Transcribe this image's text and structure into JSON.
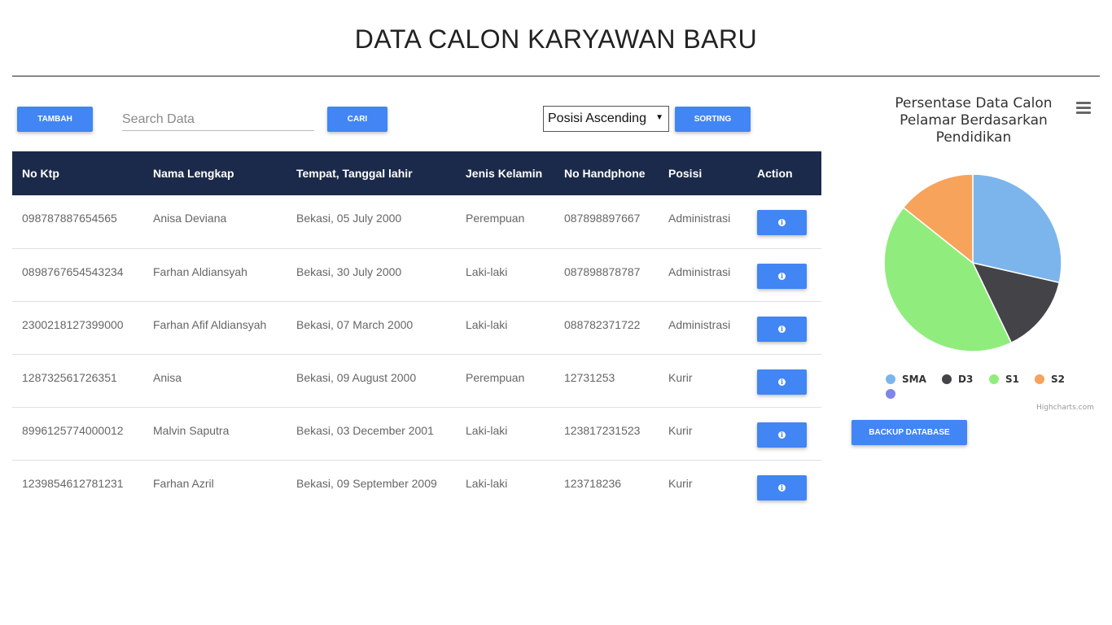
{
  "header": {
    "title": "DATA CALON KARYAWAN BARU"
  },
  "toolbar": {
    "add_label": "TAMBAH",
    "search_placeholder": "Search Data",
    "search_value": "",
    "search_label": "CARI",
    "sort_selected": "Posisi Ascending",
    "sort_label": "SORTING"
  },
  "table": {
    "columns": [
      "No Ktp",
      "Nama Lengkap",
      "Tempat, Tanggal lahir",
      "Jenis Kelamin",
      "No Handphone",
      "Posisi",
      "Action"
    ],
    "rows": [
      [
        "098787887654565",
        "Anisa Deviana",
        "Bekasi, 05 July 2000",
        "Perempuan",
        "087898897667",
        "Administrasi"
      ],
      [
        "0898767654543234",
        "Farhan Aldiansyah",
        "Bekasi, 30 July 2000",
        "Laki-laki",
        "087898878787",
        "Administrasi"
      ],
      [
        "2300218127399000",
        "Farhan Afif Aldiansyah",
        "Bekasi, 07 March 2000",
        "Laki-laki",
        "088782371722",
        "Administrasi"
      ],
      [
        "128732561726351",
        "Anisa",
        "Bekasi, 09 August 2000",
        "Perempuan",
        "12731253",
        "Kurir"
      ],
      [
        "8996125774000012",
        "Malvin Saputra",
        "Bekasi, 03 December 2001",
        "Laki-laki",
        "123817231523",
        "Kurir"
      ],
      [
        "1239854612781231",
        "Farhan Azril",
        "Bekasi, 09 September 2009",
        "Laki-laki",
        "123718236",
        "Kurir"
      ]
    ],
    "action_icon": "info-icon"
  },
  "chart_data": {
    "type": "pie",
    "title": "Persentase Data Calon Pelamar Berdasarkan Pendidikan",
    "series": [
      {
        "name": "SMA",
        "value": 2,
        "color": "#7cb5ec"
      },
      {
        "name": "D3",
        "value": 1,
        "color": "#434348"
      },
      {
        "name": "S1",
        "value": 3,
        "color": "#90ed7d"
      },
      {
        "name": "S2",
        "value": 1,
        "color": "#f7a35c"
      },
      {
        "name": "",
        "value": 0,
        "color": "#8085e9"
      }
    ],
    "legend_position": "bottom",
    "credits": "Highcharts.com"
  },
  "footer": {
    "backup_label": "BACKUP DATABASE"
  }
}
